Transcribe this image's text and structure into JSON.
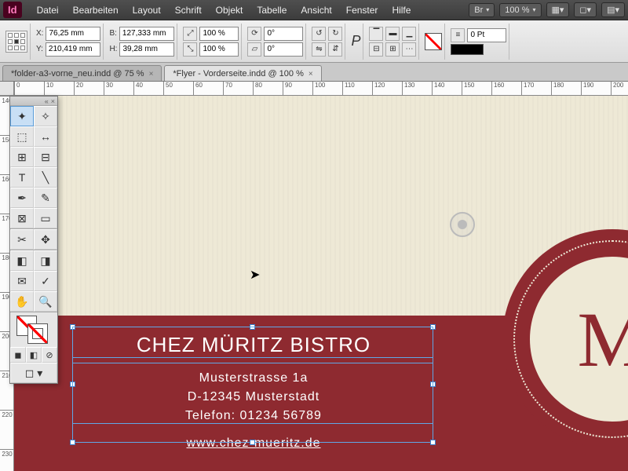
{
  "menubar": {
    "items": [
      "Datei",
      "Bearbeiten",
      "Layout",
      "Schrift",
      "Objekt",
      "Tabelle",
      "Ansicht",
      "Fenster",
      "Hilfe"
    ],
    "bridge_label": "Br",
    "zoom": "100 %"
  },
  "controlbar": {
    "x_label": "X:",
    "x_val": "76,25 mm",
    "y_label": "Y:",
    "y_val": "210,419 mm",
    "w_label": "B:",
    "w_val": "127,333 mm",
    "h_label": "H:",
    "h_val": "39,28 mm",
    "scale_x": "100 %",
    "scale_y": "100 %",
    "rotate": "0°",
    "shear": "0°",
    "stroke_pt": "0 Pt",
    "sym_p": "P"
  },
  "tabs": [
    {
      "label": "*folder-a3-vorne_neu.indd @ 75 %",
      "active": false
    },
    {
      "label": "*Flyer - Vorderseite.indd @ 100 %",
      "active": true
    }
  ],
  "ruler_h": [
    "0",
    "10",
    "20",
    "30",
    "40",
    "50",
    "60",
    "70",
    "80",
    "90",
    "100",
    "110",
    "120",
    "130",
    "140",
    "150",
    "160",
    "170",
    "180",
    "190",
    "200"
  ],
  "ruler_v": [
    "140",
    "150",
    "160",
    "170",
    "180",
    "190",
    "200",
    "210",
    "220",
    "230"
  ],
  "flyer": {
    "title": "CHEZ MÜRITZ BISTRO",
    "street": "Musterstrasse 1a",
    "city": "D-12345 Musterstadt",
    "phone": "Telefon: 01234 56789",
    "url": "www.chez-mueritz.de",
    "seal_letter": "M"
  },
  "colors": {
    "brand": "#8e2a30",
    "cream": "#eee9d6"
  }
}
